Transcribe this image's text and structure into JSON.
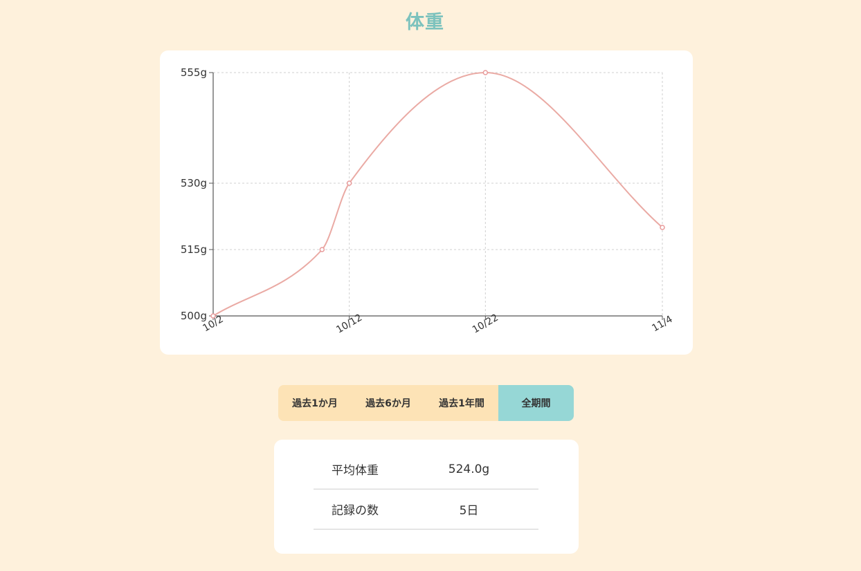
{
  "page": {
    "title": "体重"
  },
  "chart_data": {
    "type": "line",
    "x": [
      "10/2",
      "10/10",
      "10/12",
      "10/22",
      "11/4"
    ],
    "x_dates": [
      "2000-10-02",
      "2000-10-10",
      "2000-10-12",
      "2000-10-22",
      "2000-11-04"
    ],
    "xticks": [
      "10/2",
      "10/12",
      "10/22",
      "11/4"
    ],
    "yticks": [
      "500g",
      "515g",
      "530g",
      "555g"
    ],
    "ytick_values": [
      500,
      515,
      530,
      555
    ],
    "series": [
      {
        "values": [
          500,
          515,
          530,
          555,
          520
        ]
      }
    ],
    "ylim": [
      500,
      555
    ],
    "grid": true,
    "line_color": "#eaaaa4",
    "point_color": "#e89a9a",
    "grid_color": "#cfcfcf",
    "axis_color": "#555555"
  },
  "period_tabs": [
    {
      "label": "過去1か月",
      "active": false
    },
    {
      "label": "過去6か月",
      "active": false
    },
    {
      "label": "過去1年間",
      "active": false
    },
    {
      "label": "全期間",
      "active": true
    }
  ],
  "stats": {
    "rows": [
      {
        "label": "平均体重",
        "value": "524.0g"
      },
      {
        "label": "記録の数",
        "value": "5日"
      }
    ]
  },
  "colors": {
    "background": "#fef1dc",
    "title": "#7cc2bd",
    "tab_bg": "#fde3b6",
    "tab_active": "#96d7d6"
  }
}
